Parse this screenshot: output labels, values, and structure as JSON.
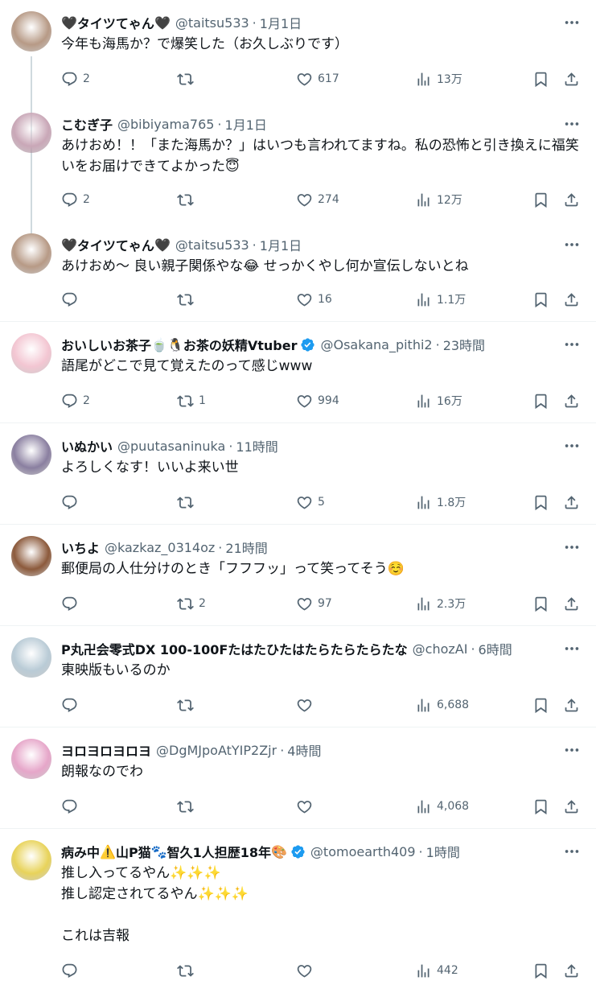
{
  "colors": {
    "secondary": "#536471",
    "text": "#0f1419",
    "verified": "#1d9bf0",
    "divider": "#eff3f4",
    "thread": "#cfd9de"
  },
  "posts": [
    {
      "name_parts": [
        "🖤",
        "タイツてゃん",
        "🖤"
      ],
      "handle": "@taitsu533",
      "time": "1月1日",
      "text": "今年も海馬か？で爆笑した（お久しぶりです）",
      "replies": "2",
      "retweets": "",
      "likes": "617",
      "views": "13万",
      "avatar_color": "#b79a86"
    },
    {
      "name_parts": [
        "こむぎ子"
      ],
      "handle": "@bibiyama765",
      "time": "1月1日",
      "text": "あけおめ！！「また海馬か？」はいつも言われてますね。私の恐怖と引き換えに福笑いをお届けできてよかった😇",
      "replies": "2",
      "retweets": "",
      "likes": "274",
      "views": "12万",
      "avatar_color": "#c9a7b7"
    },
    {
      "name_parts": [
        "🖤",
        "タイツてゃん",
        "🖤"
      ],
      "handle": "@taitsu533",
      "time": "1月1日",
      "text": "あけおめ～ 良い親子関係やな😂 せっかくやし何か宣伝しないとね",
      "replies": "",
      "retweets": "",
      "likes": "16",
      "views": "1.1万",
      "avatar_color": "#b79a86"
    },
    {
      "name_parts": [
        "おいしいお茶子",
        "🍵🐧",
        "お茶の妖精Vtuber"
      ],
      "handle": "@Osakana_pithi2",
      "time": "23時間",
      "text": "語尾がどこで見て覚えたのって感じwww",
      "replies": "2",
      "retweets": "1",
      "likes": "994",
      "views": "16万",
      "verified": true,
      "avatar_color": "#f3c6d2"
    },
    {
      "name_parts": [
        "いぬかい"
      ],
      "handle": "@puutasaninuka",
      "time": "11時間",
      "text": "よろしくなす！いいよ来い世",
      "replies": "",
      "retweets": "",
      "likes": "5",
      "views": "1.8万",
      "avatar_color": "#8a7fa0"
    },
    {
      "name_parts": [
        "いちよ"
      ],
      "handle": "@kazkaz_0314oz",
      "time": "21時間",
      "text": "郵便局の人仕分けのとき「フフフッ」って笑ってそう☺️",
      "replies": "",
      "retweets": "2",
      "likes": "97",
      "views": "2.3万",
      "avatar_color": "#8c5a3c"
    },
    {
      "name_parts": [
        "P丸卍会零式DX 100-100Fたはたひたはたらたらたらたな"
      ],
      "handle": "@chozAI",
      "time": "6時間",
      "text": "東映版もいるのか",
      "replies": "",
      "retweets": "",
      "likes": "",
      "views": "6,688",
      "avatar_color": "#b9cbd6"
    },
    {
      "name_parts": [
        "ヨロヨロヨロヨ"
      ],
      "handle": "@DgMJpoAtYIP2Zjr",
      "time": "4時間",
      "text": "朗報なのでわ",
      "replies": "",
      "retweets": "",
      "likes": "",
      "views": "4,068",
      "avatar_color": "#e6a6c9"
    },
    {
      "name_parts": [
        "病み中",
        "⚠️",
        "山P猫",
        "🐾",
        "智久1人担歴18年",
        "🎨"
      ],
      "handle": "@tomoearth409",
      "time": "1時間",
      "text": "推し入ってるやん✨✨✨\n推し認定されてるやん✨✨✨\n\nこれは吉報",
      "replies": "",
      "retweets": "",
      "likes": "",
      "views": "442",
      "verified": true,
      "avatar_color": "#e8d35a"
    }
  ]
}
